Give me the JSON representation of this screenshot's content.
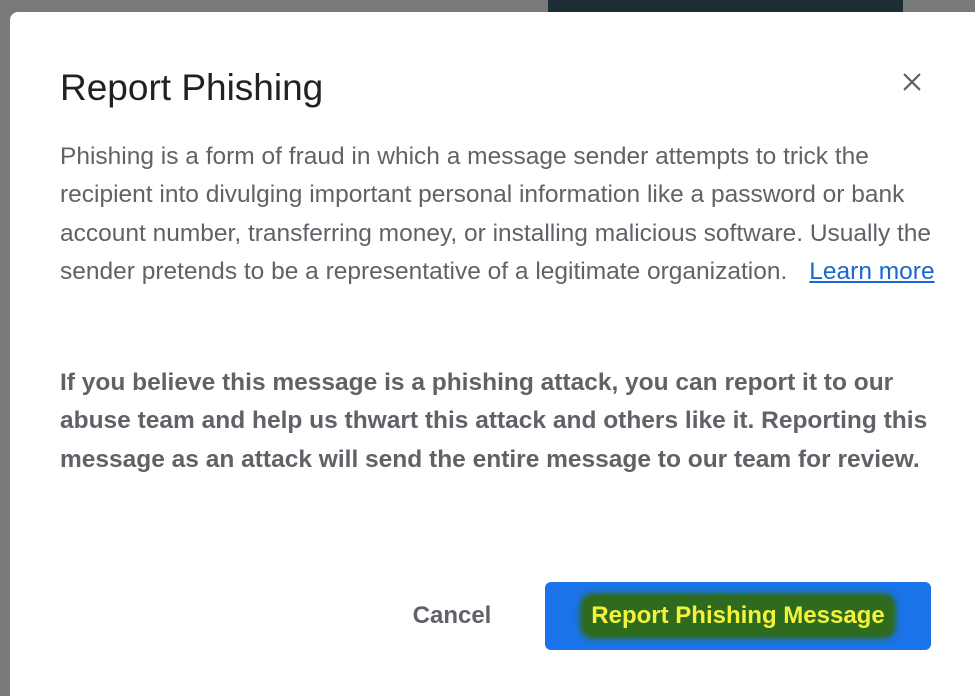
{
  "dialog": {
    "title": "Report Phishing",
    "close_icon": "close-icon",
    "description": "Phishing is a form of fraud in which a message sender attempts to trick the recipient into divulging important personal information like a password or bank account number, transferring money, or installing malicious software. Usually the sender pretends to be a representative of a legitimate organization.",
    "learn_more_label": "Learn more",
    "notice": "If you believe this message is a phishing attack, you can report it to our abuse team and help us thwart this attack and others like it. Reporting this message as an attack will send the entire message to our team for review.",
    "cancel_label": "Cancel",
    "report_label": "Report Phishing Message"
  },
  "colors": {
    "primary_button": "#1a73e8",
    "link": "#1967d2",
    "body_text": "#5f6368",
    "title_text": "#202124"
  }
}
